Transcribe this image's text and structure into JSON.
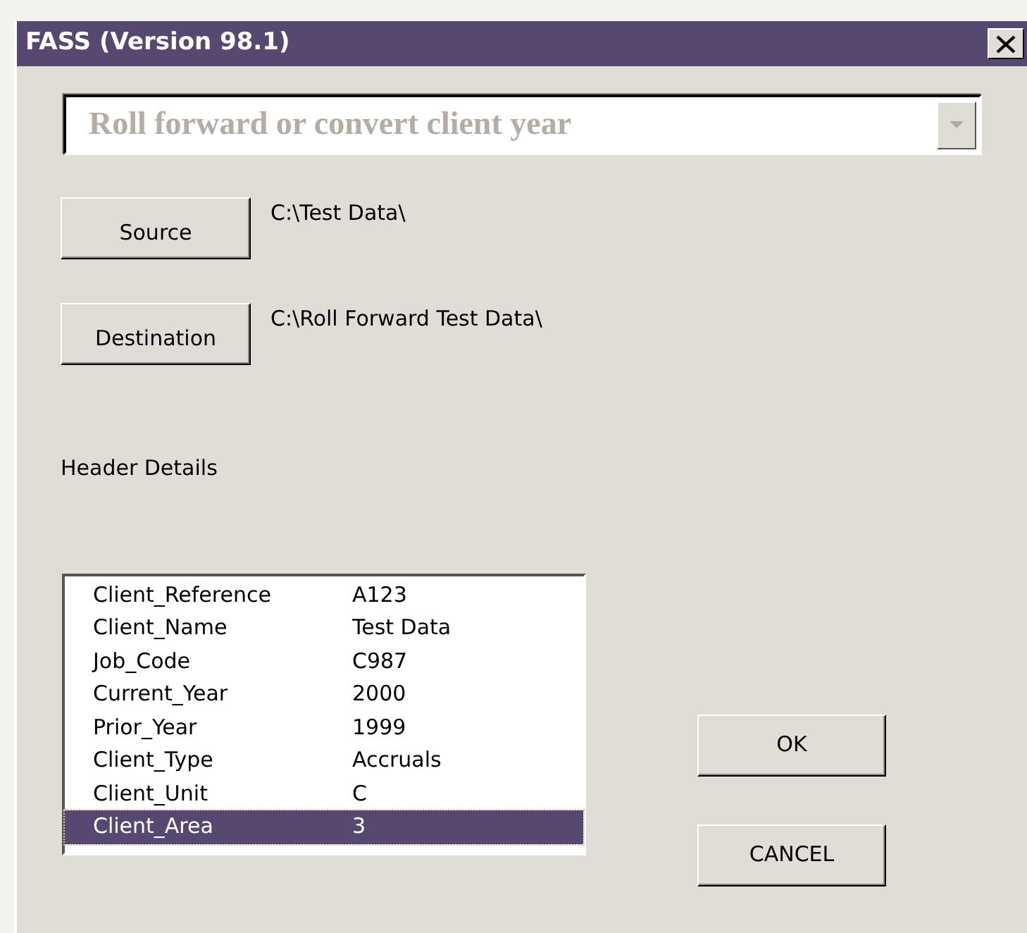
{
  "window": {
    "title": "FASS (Version 98.1)"
  },
  "mode_dropdown": {
    "value": "Roll forward or convert client year",
    "disabled": true
  },
  "paths": [
    {
      "button": "Source",
      "path": "C:\\Test Data\\"
    },
    {
      "button": "Destination",
      "path": "C:\\Roll Forward Test Data\\"
    }
  ],
  "header_label": "Header Details",
  "header_list": [
    {
      "field": "Client_Reference",
      "value": "A123",
      "selected": false
    },
    {
      "field": "Client_Name",
      "value": "Test Data",
      "selected": false
    },
    {
      "field": "Job_Code",
      "value": "C987",
      "selected": false
    },
    {
      "field": "Current_Year",
      "value": "2000",
      "selected": false
    },
    {
      "field": "Prior_Year",
      "value": "1999",
      "selected": false
    },
    {
      "field": "Client_Type",
      "value": "Accruals",
      "selected": false
    },
    {
      "field": "Client_Unit",
      "value": "C",
      "selected": false
    },
    {
      "field": "Client_Area",
      "value": "3",
      "selected": true
    }
  ],
  "buttons": [
    "OK",
    "CANCEL"
  ]
}
